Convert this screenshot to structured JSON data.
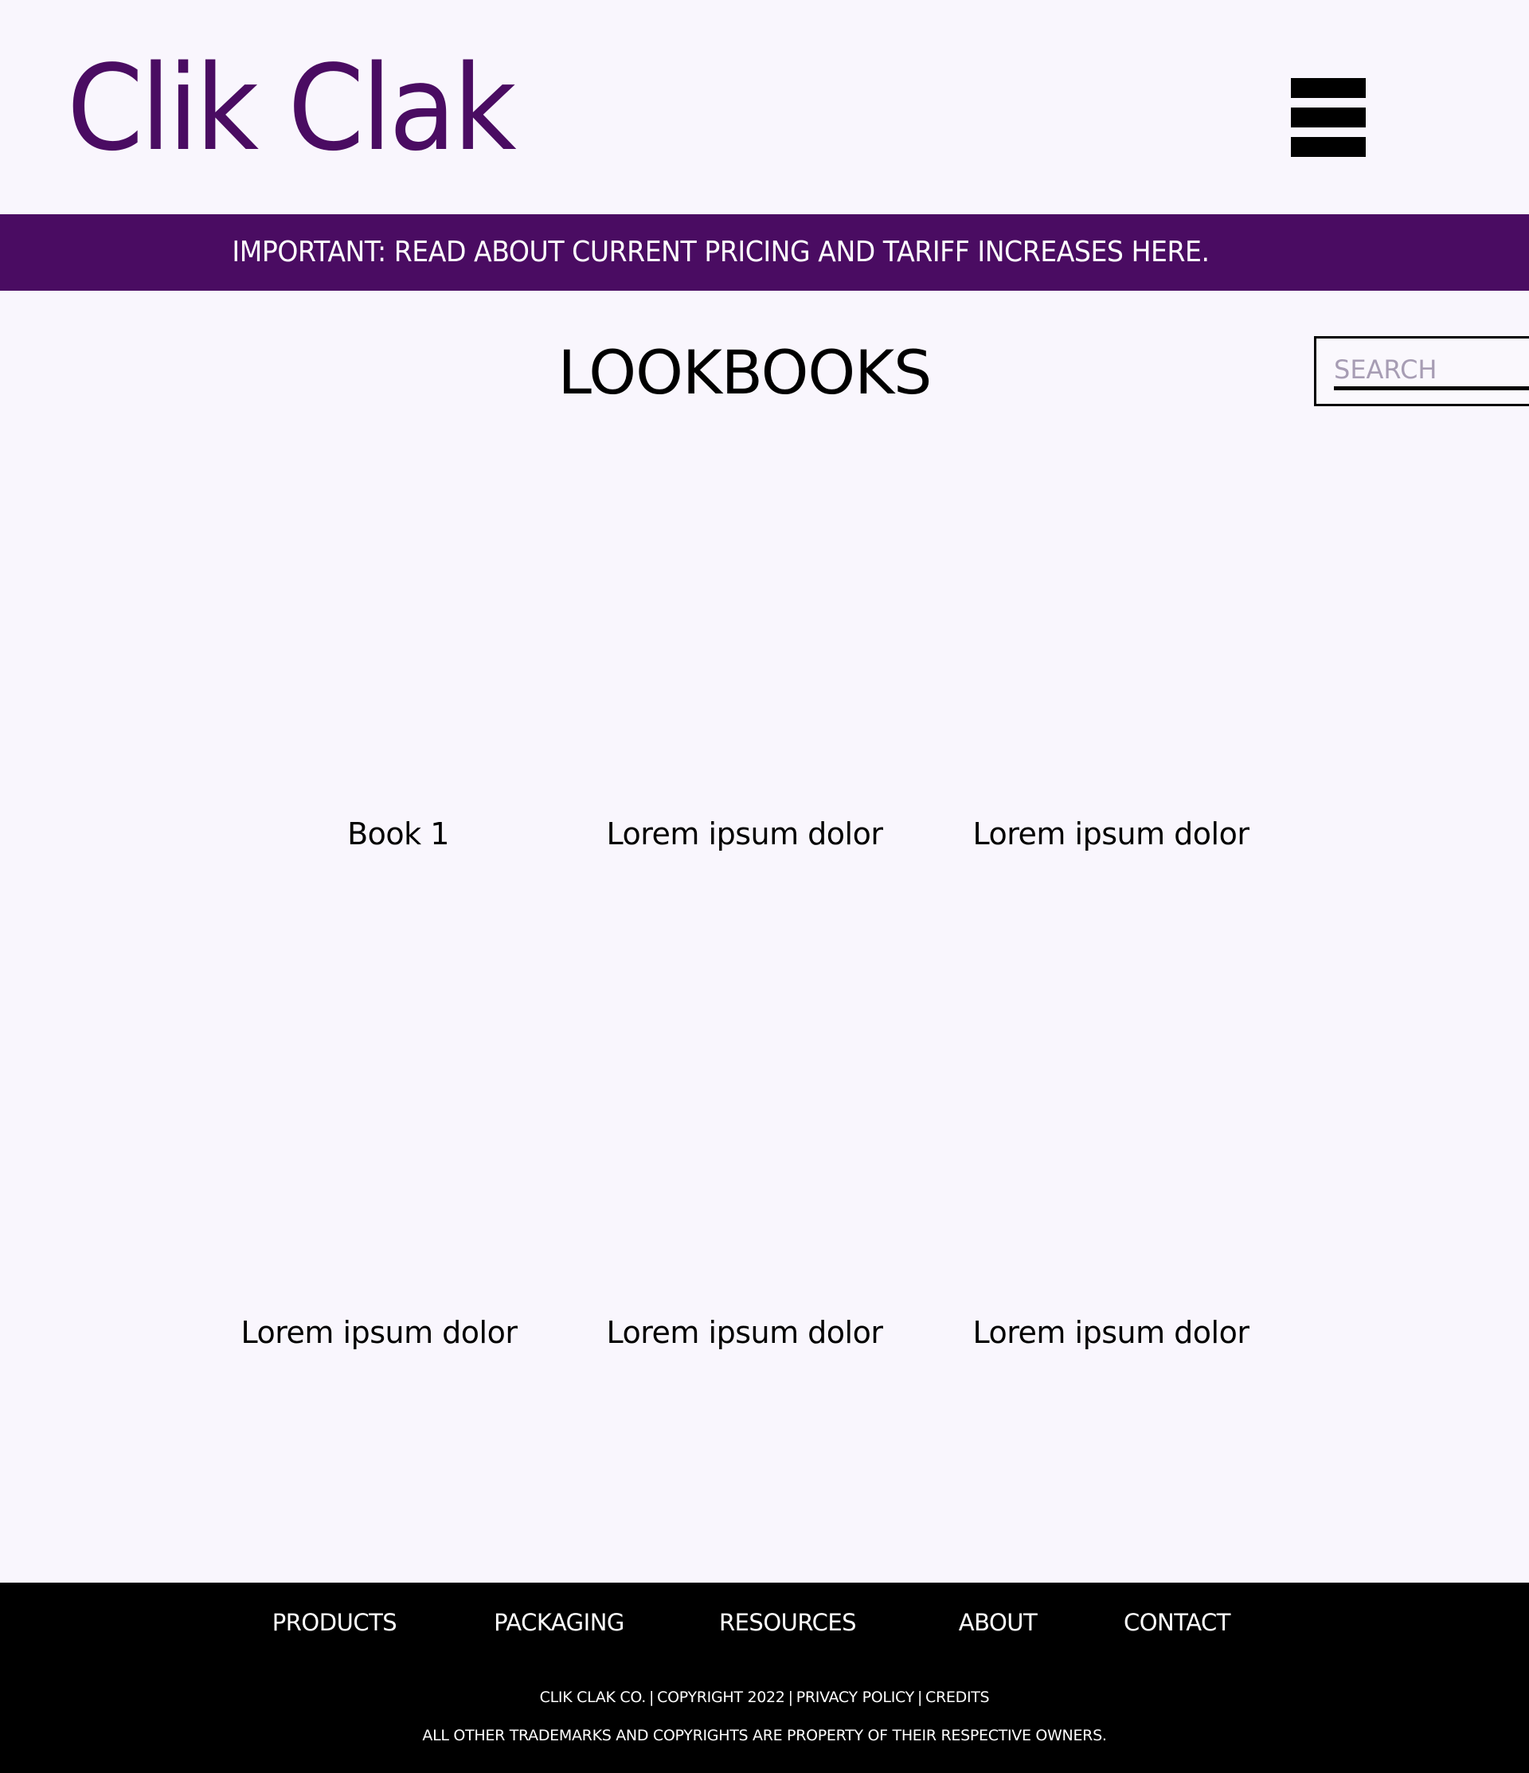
{
  "header": {
    "logo": "Clik Clak",
    "menu_icon": "hamburger-menu-icon"
  },
  "banner": {
    "text": "IMPORTANT: READ ABOUT CURRENT PRICING AND TARIFF INCREASES HERE.",
    "background_color": "#4a0c62"
  },
  "main": {
    "title": "LOOKBOOKS",
    "search": {
      "placeholder": "SEARCH",
      "value": ""
    },
    "books": [
      {
        "label": "Book 1"
      },
      {
        "label": "Lorem ipsum dolor"
      },
      {
        "label": "Lorem ipsum dolor"
      },
      {
        "label": "Lorem ipsum dolor"
      },
      {
        "label": "Lorem ipsum dolor"
      },
      {
        "label": "Lorem ipsum dolor"
      }
    ]
  },
  "footer": {
    "nav": [
      {
        "label": "PRODUCTS"
      },
      {
        "label": "PACKAGING"
      },
      {
        "label": "RESOURCES"
      },
      {
        "label": "ABOUT"
      },
      {
        "label": "CONTACT"
      }
    ],
    "company": "CLIK CLAK CO.",
    "copyright": "COPYRIGHT 2022",
    "privacy": "PRIVACY POLICY",
    "credits": "CREDITS",
    "separator": "|",
    "disclaimer": "ALL OTHER TRADEMARKS AND COPYRIGHTS ARE PROPERTY OF THEIR RESPECTIVE OWNERS."
  }
}
